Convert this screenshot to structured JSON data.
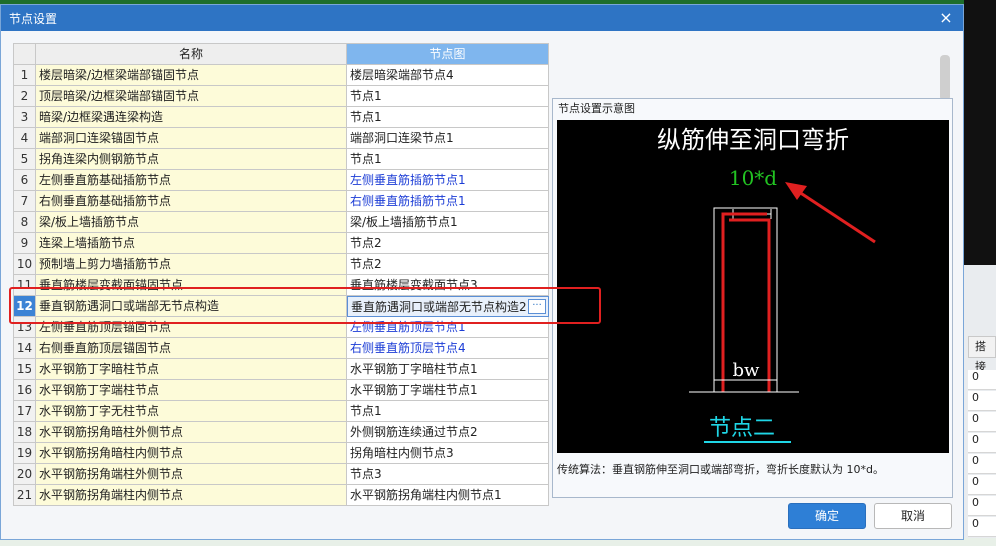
{
  "dialog": {
    "title": "节点设置",
    "close_glyph": "×"
  },
  "table": {
    "headers": {
      "name": "名称",
      "node": "节点图"
    },
    "rows": [
      {
        "no": "1",
        "name": "楼层暗梁/边框梁端部锚固节点",
        "node": "楼层暗梁端部节点4"
      },
      {
        "no": "2",
        "name": "顶层暗梁/边框梁端部锚固节点",
        "node": "节点1"
      },
      {
        "no": "3",
        "name": "暗梁/边框梁遇连梁构造",
        "node": "节点1"
      },
      {
        "no": "4",
        "name": "端部洞口连梁锚固节点",
        "node": "端部洞口连梁节点1"
      },
      {
        "no": "5",
        "name": "拐角连梁内侧钢筋节点",
        "node": "节点1"
      },
      {
        "no": "6",
        "name": "左侧垂直筋基础插筋节点",
        "node": "左侧垂直筋插筋节点1",
        "blue": true
      },
      {
        "no": "7",
        "name": "右侧垂直筋基础插筋节点",
        "node": "右侧垂直筋插筋节点1",
        "blue": true
      },
      {
        "no": "8",
        "name": "梁/板上墙插筋节点",
        "node": "梁/板上墙插筋节点1"
      },
      {
        "no": "9",
        "name": "连梁上墙插筋节点",
        "node": "节点2"
      },
      {
        "no": "10",
        "name": "预制墙上剪力墙插筋节点",
        "node": "节点2"
      },
      {
        "no": "11",
        "name": "垂直筋楼层变截面锚固节点",
        "node": "垂直筋楼层变截面节点3"
      },
      {
        "no": "12",
        "name": "垂直钢筋遇洞口或端部无节点构造",
        "node": "垂直筋遇洞口或端部无节点构造2",
        "selected": true
      },
      {
        "no": "13",
        "name": "左侧垂直筋顶层锚固节点",
        "node": "左侧垂直筋顶层节点1",
        "blue": true
      },
      {
        "no": "14",
        "name": "右侧垂直筋顶层锚固节点",
        "node": "右侧垂直筋顶层节点4",
        "blue": true
      },
      {
        "no": "15",
        "name": "水平钢筋丁字暗柱节点",
        "node": "水平钢筋丁字暗柱节点1"
      },
      {
        "no": "16",
        "name": "水平钢筋丁字端柱节点",
        "node": "水平钢筋丁字端柱节点1"
      },
      {
        "no": "17",
        "name": "水平钢筋丁字无柱节点",
        "node": "节点1"
      },
      {
        "no": "18",
        "name": "水平钢筋拐角暗柱外侧节点",
        "node": "外侧钢筋连续通过节点2"
      },
      {
        "no": "19",
        "name": "水平钢筋拐角暗柱内侧节点",
        "node": "拐角暗柱内侧节点3"
      },
      {
        "no": "20",
        "name": "水平钢筋拐角端柱外侧节点",
        "node": "节点3"
      },
      {
        "no": "21",
        "name": "水平钢筋拐角端柱内侧节点",
        "node": "水平钢筋拐角端柱内侧节点1"
      }
    ],
    "more_glyph": "···"
  },
  "preview": {
    "panel_title": "节点设置示意图",
    "drawing_title": "纵筋伸至洞口弯折",
    "dimension_label": "10*d",
    "width_label": "bw",
    "caption": "节点二",
    "description": "传统算法：垂直钢筋伸至洞口或端部弯折，弯折长度默认为 10*d。"
  },
  "buttons": {
    "ok": "确定",
    "cancel": "取消"
  },
  "background": {
    "col_header": "搭接",
    "cells": [
      "0",
      "0",
      "0",
      "0",
      "0",
      "0",
      "0",
      "0"
    ]
  }
}
